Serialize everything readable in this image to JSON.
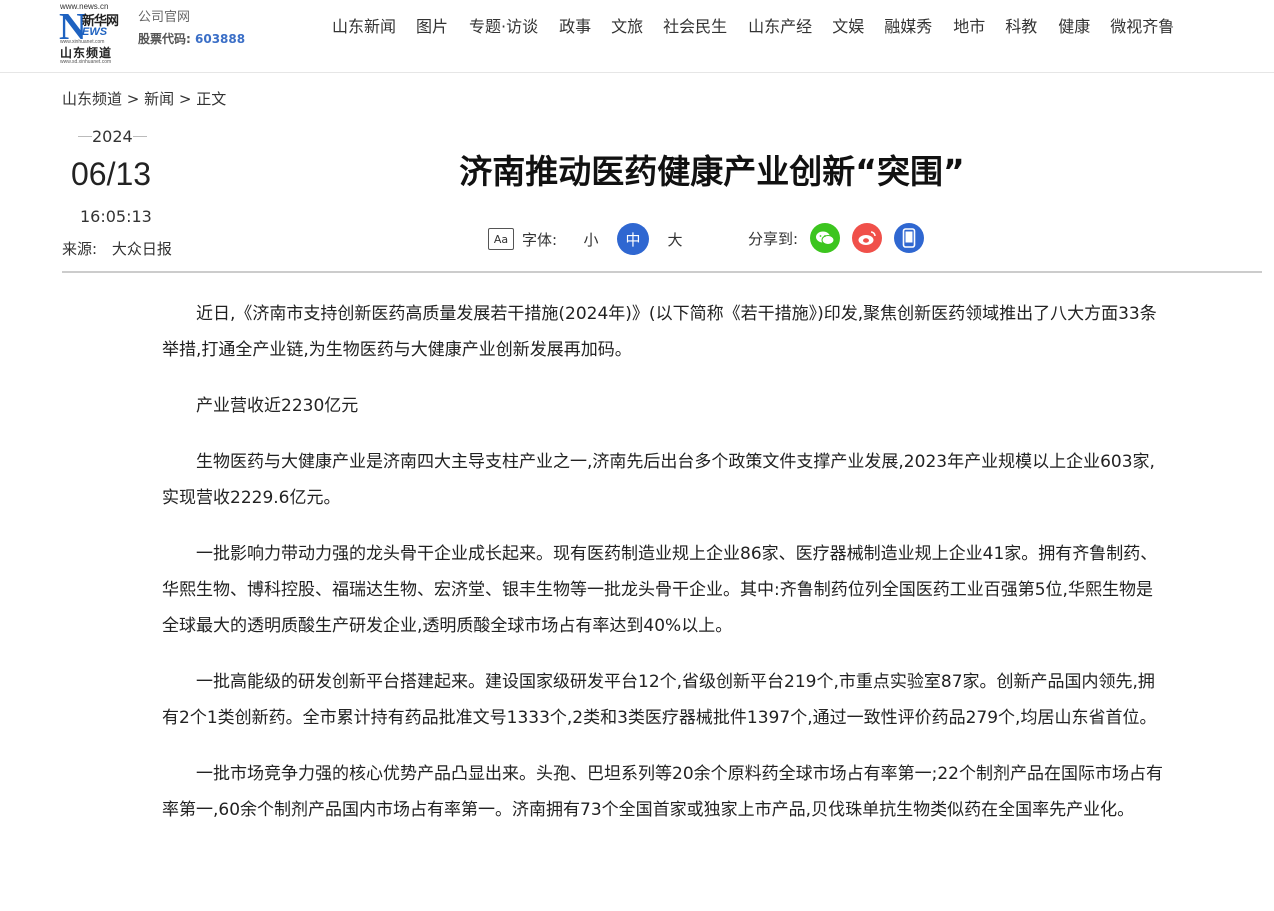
{
  "header": {
    "logo": {
      "site_url": "www.news.cn",
      "brand_letter": "N",
      "brand_cn": "新华网",
      "brand_en": "EWS",
      "brand_sub": "www.xinhuanet.com",
      "channel": "山东频道",
      "channel_url": "www.sd.xinhuanet.com"
    },
    "official_label": "公司官网",
    "stock_label": "股票代码:",
    "stock_code": "603888",
    "nav": [
      "山东新闻",
      "图片",
      "专题·访谈",
      "政事",
      "文旅",
      "社会民生",
      "山东产经",
      "文娱",
      "融媒秀",
      "地市",
      "科教",
      "健康",
      "微视齐鲁"
    ]
  },
  "breadcrumb": "山东频道 > 新闻 > 正文",
  "meta": {
    "year": "2024",
    "date": "06/13",
    "time": "16:05:13",
    "source_label": "来源:",
    "source": "大众日报"
  },
  "title": "济南推动医药健康产业创新“突围”",
  "font_control": {
    "label": "字体:",
    "aa_icon": "font-size-icon",
    "aa_text": "Aa",
    "sizes": [
      "小",
      "中",
      "大"
    ],
    "active_size": "中"
  },
  "share": {
    "label": "分享到:",
    "targets": [
      "wechat-icon",
      "weibo-icon",
      "mobile-icon"
    ]
  },
  "colors": {
    "accent": "#2f67d1",
    "wechat": "#3cc51f",
    "weibo": "#f0504a"
  },
  "article": {
    "paragraphs": [
      "近日,《济南市支持创新医药高质量发展若干措施(2024年)》(以下简称《若干措施》)印发,聚焦创新医药领域推出了八大方面33条举措,打通全产业链,为生物医药与大健康产业创新发展再加码。",
      "产业营收近2230亿元",
      "生物医药与大健康产业是济南四大主导支柱产业之一,济南先后出台多个政策文件支撑产业发展,2023年产业规模以上企业603家,实现营收2229.6亿元。",
      "一批影响力带动力强的龙头骨干企业成长起来。现有医药制造业规上企业86家、医疗器械制造业规上企业41家。拥有齐鲁制药、华熙生物、博科控股、福瑞达生物、宏济堂、银丰生物等一批龙头骨干企业。其中:齐鲁制药位列全国医药工业百强第5位,华熙生物是全球最大的透明质酸生产研发企业,透明质酸全球市场占有率达到40%以上。",
      "一批高能级的研发创新平台搭建起来。建设国家级研发平台12个,省级创新平台219个,市重点实验室87家。创新产品国内领先,拥有2个1类创新药。全市累计持有药品批准文号1333个,2类和3类医疗器械批件1397个,通过一致性评价药品279个,均居山东省首位。",
      "一批市场竞争力强的核心优势产品凸显出来。头孢、巴坦系列等20余个原料药全球市场占有率第一;22个制剂产品在国际市场占有率第一,60余个制剂产品国内市场占有率第一。济南拥有73个全国首家或独家上市产品,贝伐珠单抗生物类似药在全国率先产业化。"
    ]
  }
}
